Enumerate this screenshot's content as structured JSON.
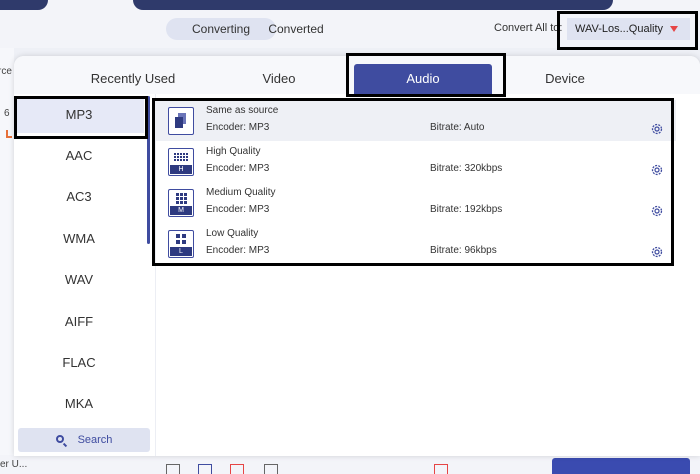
{
  "app": {
    "segments": {
      "converting": "Converting",
      "converted": "Converted"
    },
    "convert_all_label": "Convert All to:",
    "convert_all_value": "WAV-Los...Quality",
    "left_partial_1": "rce",
    "left_partial_2": "6",
    "bottom_left_text": "er U..."
  },
  "popup": {
    "tabs": {
      "recent": "Recently Used",
      "video": "Video",
      "audio": "Audio",
      "device": "Device"
    },
    "formats": [
      "MP3",
      "AAC",
      "AC3",
      "WMA",
      "WAV",
      "AIFF",
      "FLAC",
      "MKA"
    ],
    "search_label": "Search",
    "presets": [
      {
        "name": "Same as source",
        "encoder": "Encoder: MP3",
        "bitrate": "Bitrate: Auto",
        "badge": ""
      },
      {
        "name": "High Quality",
        "encoder": "Encoder: MP3",
        "bitrate": "Bitrate: 320kbps",
        "badge": "H"
      },
      {
        "name": "Medium Quality",
        "encoder": "Encoder: MP3",
        "bitrate": "Bitrate: 192kbps",
        "badge": "M"
      },
      {
        "name": "Low Quality",
        "encoder": "Encoder: MP3",
        "bitrate": "Bitrate: 96kbps",
        "badge": "L"
      }
    ]
  },
  "colors": {
    "accent": "#3f4ca0",
    "accent_dark": "#2f3a6b",
    "caret": "#e64545"
  }
}
